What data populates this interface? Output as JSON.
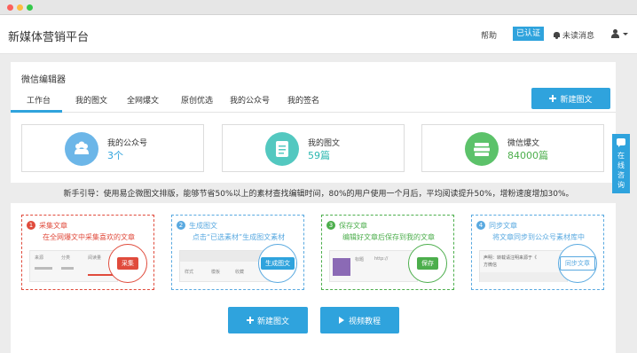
{
  "window": {
    "controls": [
      "close",
      "minimize",
      "maximize"
    ]
  },
  "header": {
    "brand": "新媒体营销平台",
    "help": "帮助",
    "certified": "已认证",
    "messages": "未读消息"
  },
  "editor": {
    "title": "微信编辑器",
    "tabs": [
      {
        "label": "工作台",
        "active": true
      },
      {
        "label": "我的图文"
      },
      {
        "label": "全网爆文"
      },
      {
        "label": "原创优选"
      },
      {
        "label": "我的公众号"
      },
      {
        "label": "我的签名"
      }
    ],
    "new_button": "新建图文",
    "stats": [
      {
        "label": "我的公众号",
        "value": "3个",
        "color": "#6cb6e8"
      },
      {
        "label": "我的图文",
        "value": "59篇",
        "color": "#53c8c0"
      },
      {
        "label": "微信爆文",
        "value": "84000篇",
        "color": "#5cc26a"
      }
    ]
  },
  "guide": "新手引导：使用易企微图文排版，能够节省50%以上的素材查找编辑时间，80%的用户使用一个月后，平均阅读提升50%，增粉速度增加30%。",
  "steps": [
    {
      "num": "1",
      "title": "采集文章",
      "desc": "在全网爆文中采集喜欢的文章",
      "chip": "采集",
      "color": "#e04b3c",
      "mock_texts": [
        "来源",
        "分类",
        "阅读量"
      ]
    },
    {
      "num": "2",
      "title": "生成图文",
      "desc": "点击“已选素材”生成图文素材",
      "chip": "生成图文",
      "color": "#59a9e0",
      "mock_texts": [
        "样式",
        "模板",
        "收藏"
      ]
    },
    {
      "num": "3",
      "title": "保存文章",
      "desc": "编辑好文章后保存到我的文章",
      "chip": "保存",
      "color": "#4cae4c",
      "mock_texts": [
        "标题",
        "http://"
      ]
    },
    {
      "num": "4",
      "title": "同步文章",
      "desc": "将文章同步到公众号素材库中",
      "chip": "同步文章",
      "color": "#59a9e0",
      "mock_texts": [
        "声明：转载请注明来源于《",
        "方微信"
      ]
    }
  ],
  "bottom": {
    "new_button": "新建图文",
    "video_button": "视频教程"
  },
  "side": {
    "label": "在线咨询"
  }
}
